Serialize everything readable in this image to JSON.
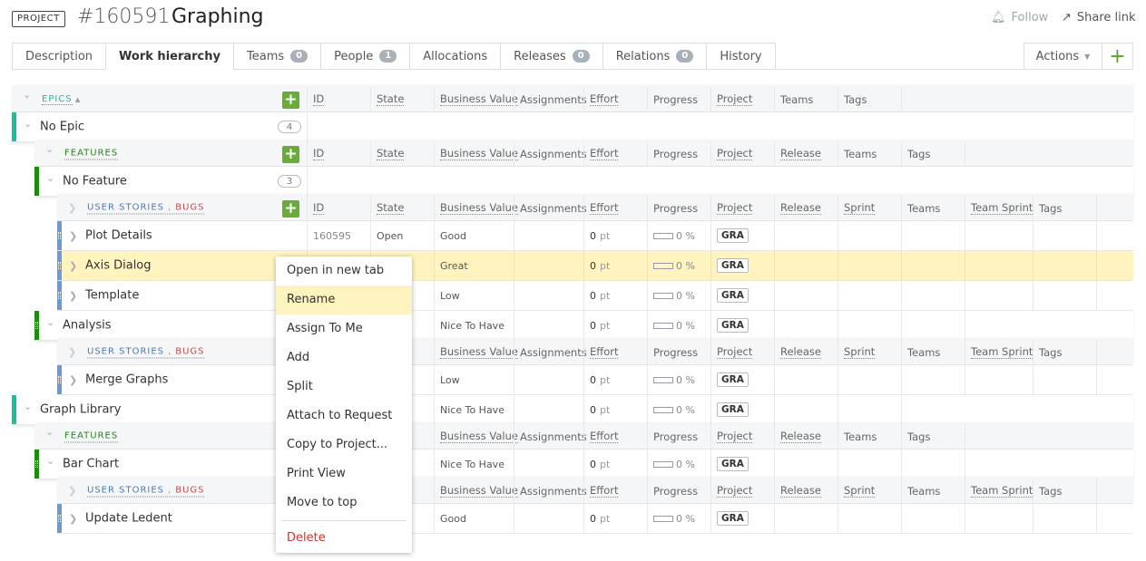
{
  "header": {
    "badge": "PROJECT",
    "id": "#160591",
    "name": "Graphing",
    "follow": "Follow",
    "share": "Share link"
  },
  "tabs": [
    {
      "label": "Description"
    },
    {
      "label": "Work hierarchy",
      "active": true
    },
    {
      "label": "Teams",
      "count": "0"
    },
    {
      "label": "People",
      "count": "1"
    },
    {
      "label": "Allocations"
    },
    {
      "label": "Releases",
      "count": "0"
    },
    {
      "label": "Relations",
      "count": "0"
    },
    {
      "label": "History"
    }
  ],
  "toolbar": {
    "actions": "Actions",
    "add": "+"
  },
  "levels": {
    "epics": "EPICS",
    "features": "FEATURES",
    "user_stories": "USER STORIES",
    "bugs": "BUGS",
    "sep": ","
  },
  "columns": {
    "epic": [
      "ID",
      "State",
      "Business Value",
      "Assignments",
      "Effort",
      "Progress",
      "Project",
      "Teams",
      "Tags"
    ],
    "feature": [
      "ID",
      "State",
      "Business Value",
      "Assignments",
      "Effort",
      "Progress",
      "Project",
      "Release",
      "Teams",
      "Tags"
    ],
    "story": [
      "ID",
      "State",
      "Business Value",
      "Assignments",
      "Effort",
      "Progress",
      "Project",
      "Release",
      "Sprint",
      "Teams",
      "Team Sprint",
      "Tags"
    ]
  },
  "rows": {
    "no_epic": {
      "title": "No Epic",
      "count": "4"
    },
    "no_feature": {
      "title": "No Feature",
      "count": "3"
    },
    "plot_details": {
      "title": "Plot Details",
      "id": "160595",
      "state": "Open",
      "bv": "Good",
      "effort": "0",
      "unit": "pt",
      "progress": "0 %",
      "project": "GRA"
    },
    "axis_dialog": {
      "title": "Axis Dialog",
      "bv": "Great",
      "effort": "0",
      "unit": "pt",
      "progress": "0 %",
      "project": "GRA"
    },
    "template": {
      "title": "Template",
      "bv": "Low",
      "effort": "0",
      "unit": "pt",
      "progress": "0 %",
      "project": "GRA"
    },
    "analysis": {
      "title": "Analysis",
      "bv": "Nice To Have",
      "effort": "0",
      "unit": "pt",
      "progress": "0 %",
      "project": "GRA"
    },
    "merge_graphs": {
      "title": "Merge Graphs",
      "bv": "Low",
      "effort": "0",
      "unit": "pt",
      "progress": "0 %",
      "project": "GRA"
    },
    "graph_library": {
      "title": "Graph Library",
      "bv": "Nice To Have",
      "effort": "0",
      "unit": "pt",
      "progress": "0 %",
      "project": "GRA"
    },
    "bar_chart": {
      "title": "Bar Chart",
      "bv": "Nice To Have",
      "effort": "0",
      "unit": "pt",
      "progress": "0 %",
      "project": "GRA"
    },
    "update_ledent": {
      "title": "Update Ledent",
      "bv": "Good",
      "effort": "0",
      "unit": "pt",
      "progress": "0 %",
      "project": "GRA"
    }
  },
  "context_menu": [
    "Open in new tab",
    "Rename",
    "Assign To Me",
    "Add",
    "Split",
    "Attach to Request",
    "Copy to Project...",
    "Print View",
    "Move to top",
    "Delete"
  ],
  "colors": {
    "epic": "#19c0a0",
    "feature": "#1f8a12",
    "story": "#6a9ad8",
    "bug": "#c0504d",
    "add": "#6aab3a",
    "highlight": "#fff4c0",
    "delete": "#d32f2f"
  }
}
